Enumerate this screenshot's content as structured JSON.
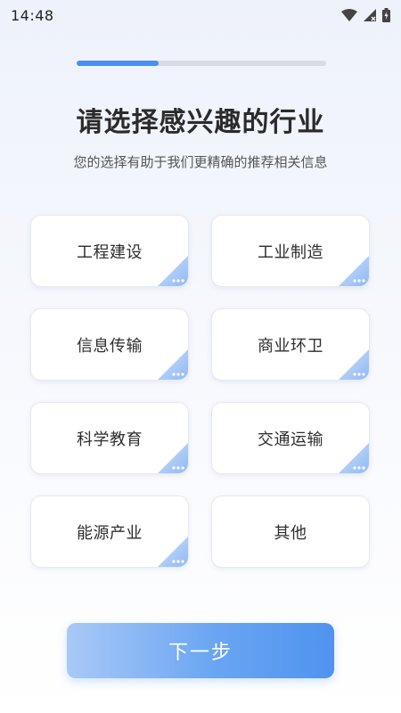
{
  "status_bar": {
    "time": "14:48",
    "icons": [
      "wifi-icon",
      "signal-icon",
      "battery-icon"
    ]
  },
  "progress": {
    "fraction": 0.33,
    "accent_color": "#4a8ff0"
  },
  "header": {
    "title": "请选择感兴趣的行业",
    "subtitle": "您的选择有助于我们更精确的推荐相关信息"
  },
  "industries": [
    {
      "label": "工程建设",
      "has_corner": true
    },
    {
      "label": "工业制造",
      "has_corner": true
    },
    {
      "label": "信息传输",
      "has_corner": true
    },
    {
      "label": "商业环卫",
      "has_corner": true
    },
    {
      "label": "科学教育",
      "has_corner": true
    },
    {
      "label": "交通运输",
      "has_corner": true
    },
    {
      "label": "能源产业",
      "has_corner": true
    },
    {
      "label": "其他",
      "has_corner": false
    }
  ],
  "footer": {
    "next_label": "下一步",
    "button_color": "#4f93ef"
  }
}
